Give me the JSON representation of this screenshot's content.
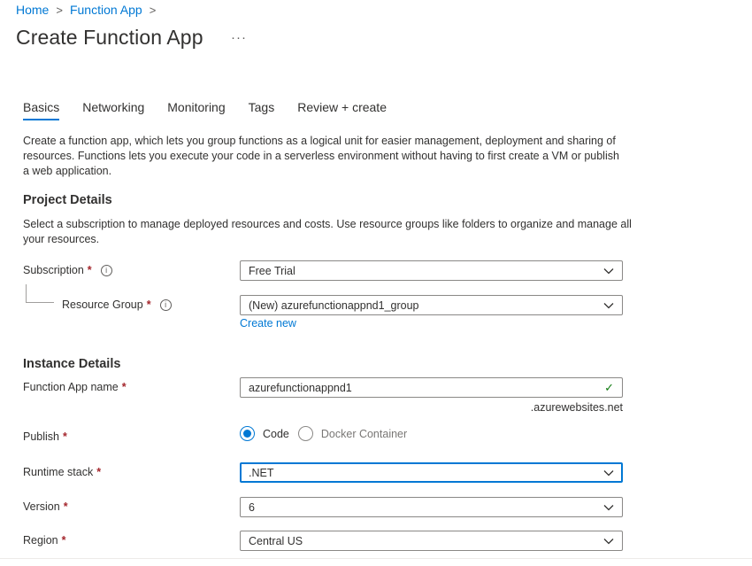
{
  "breadcrumb": {
    "home": "Home",
    "sep": ">",
    "function_app": "Function App"
  },
  "page": {
    "title": "Create Function App",
    "more": "···"
  },
  "tabs": [
    {
      "label": "Basics",
      "active": true
    },
    {
      "label": "Networking",
      "active": false
    },
    {
      "label": "Monitoring",
      "active": false
    },
    {
      "label": "Tags",
      "active": false
    },
    {
      "label": "Review + create",
      "active": false
    }
  ],
  "intro": "Create a function app, which lets you group functions as a logical unit for easier management, deployment and sharing of resources. Functions lets you execute your code in a serverless environment without having to first create a VM or publish a web application.",
  "project": {
    "heading": "Project Details",
    "description": "Select a subscription to manage deployed resources and costs. Use resource groups like folders to organize and manage all your resources.",
    "subscription": {
      "label": "Subscription",
      "value": "Free Trial"
    },
    "resource_group": {
      "label": "Resource Group",
      "value": "(New) azurefunctionappnd1_group",
      "create_new": "Create new"
    }
  },
  "instance": {
    "heading": "Instance Details",
    "name": {
      "label": "Function App name",
      "value": "azurefunctionappnd1",
      "suffix": ".azurewebsites.net"
    },
    "publish": {
      "label": "Publish",
      "options": [
        "Code",
        "Docker Container"
      ],
      "selected": "Code"
    },
    "runtime": {
      "label": "Runtime stack",
      "value": ".NET"
    },
    "version": {
      "label": "Version",
      "value": "6"
    },
    "region": {
      "label": "Region",
      "value": "Central US"
    }
  },
  "symbols": {
    "required": "*",
    "info": "i",
    "check": "✓"
  },
  "colors": {
    "accent": "#0078d4",
    "required": "#a4262c",
    "valid": "#107c10"
  }
}
